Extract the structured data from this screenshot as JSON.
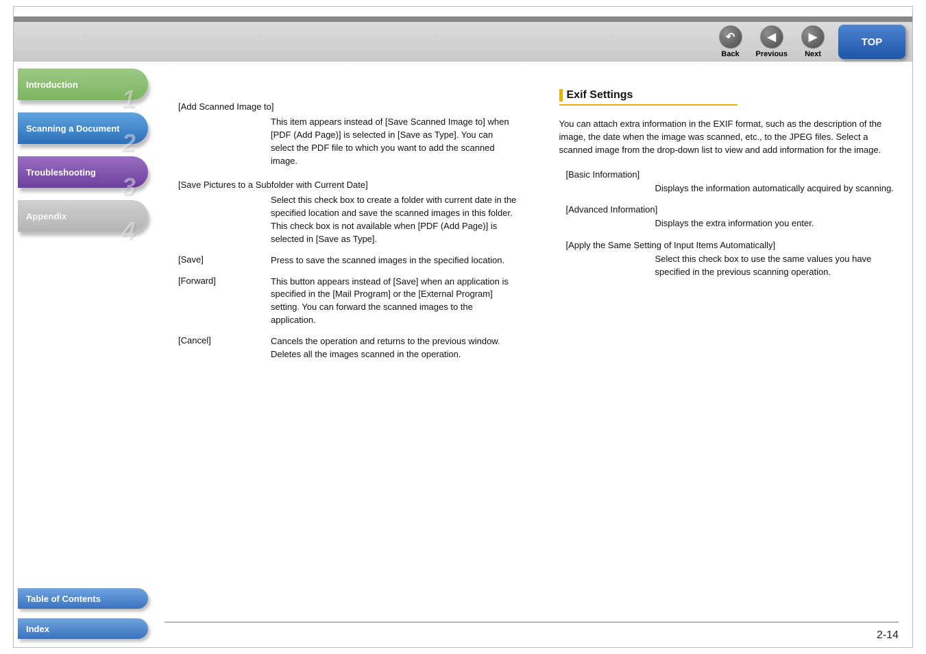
{
  "nav": {
    "back": "Back",
    "previous": "Previous",
    "next": "Next",
    "top": "TOP"
  },
  "sidebar": {
    "introduction": "Introduction",
    "scanning": "Scanning a Document",
    "troubleshooting": "Troubleshooting",
    "appendix": "Appendix",
    "n1": "1",
    "n2": "2",
    "n3": "3",
    "n4": "4"
  },
  "bottom": {
    "toc": "Table of Contents",
    "index": "Index"
  },
  "left": {
    "h1": "[Add Scanned Image to]",
    "d1": "This item appears instead of [Save Scanned Image to] when [PDF (Add Page)] is selected in [Save as Type]. You can select the PDF file to which you want to add the scanned image.",
    "h2": "[Save Pictures to a Subfolder with Current Date]",
    "d2": "Select this check box to create a folder with current date in the specified location and save the scanned images in this folder. This check box is not available when [PDF (Add Page)] is selected in [Save as Type].",
    "t_save": "[Save]",
    "d_save": "Press to save the scanned images in the specified location.",
    "t_forward": "[Forward]",
    "d_forward": "This button appears instead of [Save] when an application is specified in the [Mail Program] or the [External Program] setting. You can forward the scanned images to the application.",
    "t_cancel": "[Cancel]",
    "d_cancel": "Cancels the operation and returns to the previous window. Deletes all the images scanned in the operation."
  },
  "right": {
    "heading": "Exif Settings",
    "intro": "You can attach extra information in the EXIF format, such as the description of the image, the date when the image was scanned, etc., to the JPEG files. Select a scanned image from the drop-down list to view and add information for the image.",
    "h_basic": "[Basic Information]",
    "d_basic": "Displays the information automatically acquired by scanning.",
    "h_adv": "[Advanced Information]",
    "d_adv": "Displays the extra information you enter.",
    "h_apply": "[Apply the Same Setting of Input Items Automatically]",
    "d_apply": "Select this check box to use the same values you have specified in the previous scanning operation."
  },
  "page": "2-14"
}
